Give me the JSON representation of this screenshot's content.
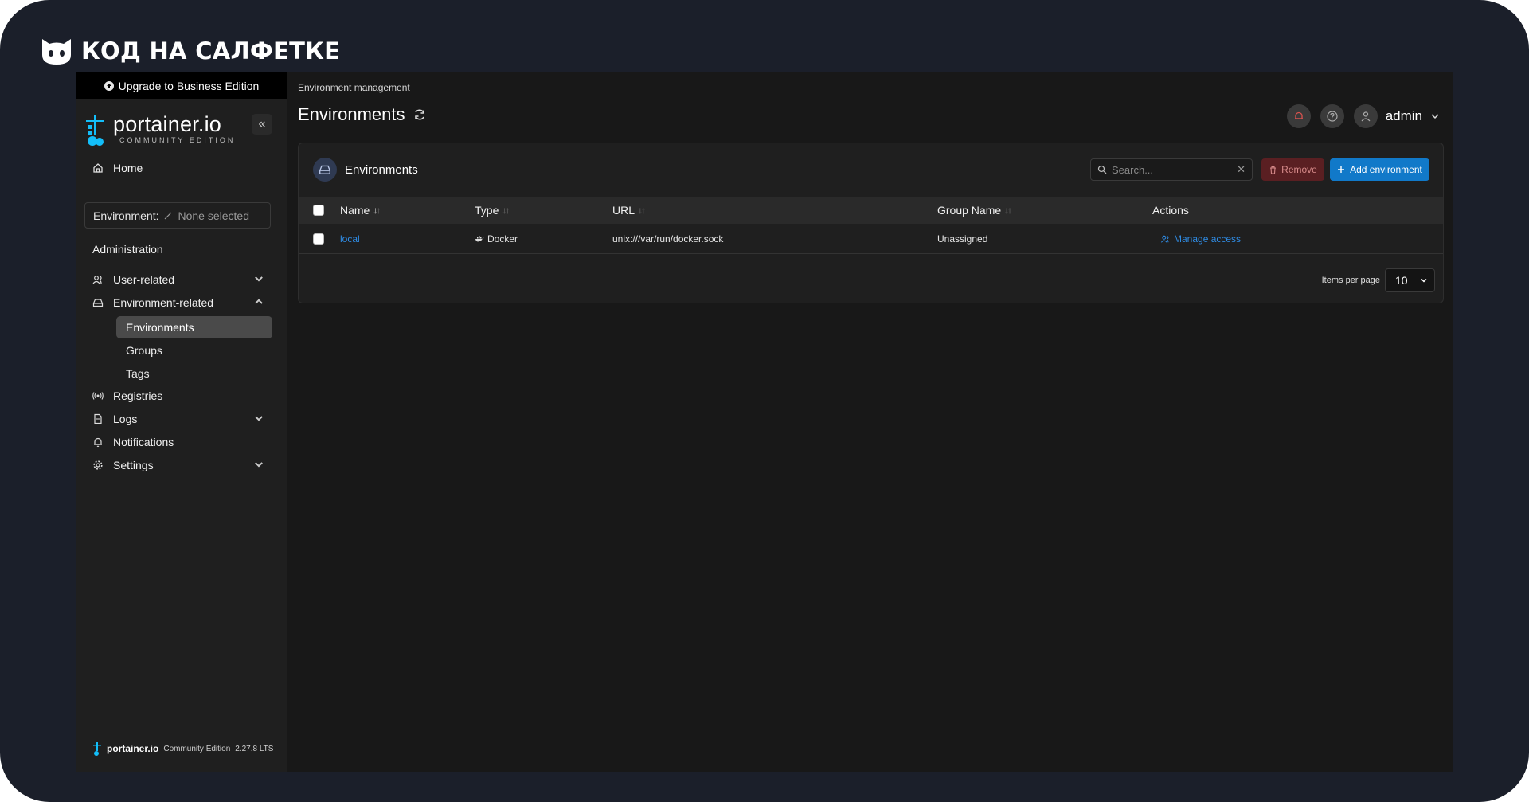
{
  "brand": {
    "text": "КОД НА САЛФЕТКЕ"
  },
  "sidebar": {
    "upgrade_label": "Upgrade to Business Edition",
    "logo_text": "portainer.io",
    "logo_sub": "COMMUNITY EDITION",
    "collapse_label": "«",
    "home_label": "Home",
    "environment_label": "Environment:",
    "environment_value": "None selected",
    "section_title": "Administration",
    "items": [
      {
        "label": "User-related",
        "icon": "users-icon"
      },
      {
        "label": "Environment-related",
        "icon": "hard-drive-icon"
      },
      {
        "label": "Registries",
        "icon": "radio-icon"
      },
      {
        "label": "Logs",
        "icon": "file-text-icon"
      },
      {
        "label": "Notifications",
        "icon": "bell-icon"
      },
      {
        "label": "Settings",
        "icon": "gear-icon"
      }
    ],
    "sub_items": [
      {
        "label": "Environments",
        "active": true
      },
      {
        "label": "Groups",
        "active": false
      },
      {
        "label": "Tags",
        "active": false
      }
    ],
    "footer_brand": "portainer.io",
    "footer_edition": "Community Edition",
    "footer_version": "2.27.8 LTS"
  },
  "header": {
    "breadcrumb": "Environment management",
    "title": "Environments",
    "user_name": "admin"
  },
  "panel": {
    "title": "Environments",
    "search_placeholder": "Search...",
    "remove_label": "Remove",
    "add_label": "Add environment",
    "columns": [
      "Name",
      "Type",
      "URL",
      "Group Name",
      "Actions"
    ],
    "rows": [
      {
        "name": "local",
        "type": "Docker",
        "url": "unix:///var/run/docker.sock",
        "group": "Unassigned",
        "action": "Manage access"
      }
    ],
    "items_per_page_label": "Items per page",
    "items_per_page_value": "10"
  },
  "colors": {
    "accent": "#1179c9",
    "link": "#2f8ce5",
    "danger_bg": "#5a1f22"
  }
}
